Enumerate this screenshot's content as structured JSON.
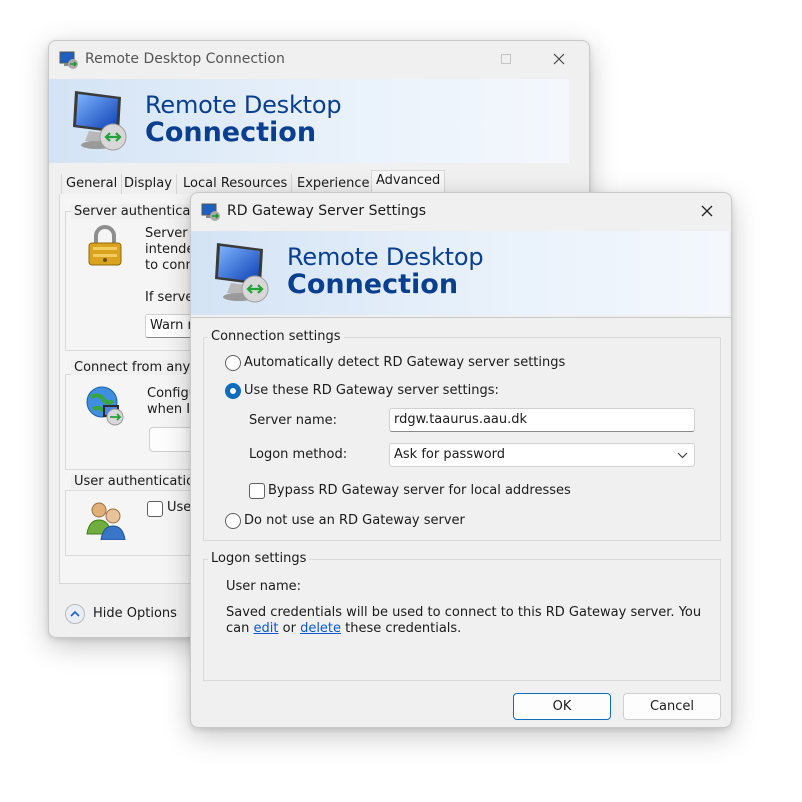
{
  "back_window": {
    "title": "Remote Desktop Connection",
    "banner": {
      "line1": "Remote Desktop",
      "line2": "Connection"
    },
    "tabs": [
      "General",
      "Display",
      "Local Resources",
      "Experience",
      "Advanced"
    ],
    "server_auth": {
      "title": "Server authenticatio",
      "text_lines": [
        "Server a",
        "intende",
        "to conn"
      ],
      "if_server": "If server",
      "select_value": "Warn m"
    },
    "connect_anywhere": {
      "title": "Connect from anywh",
      "text_lines": [
        "Configu",
        "when I a"
      ],
      "button": "S"
    },
    "user_auth": {
      "title": "User authentication",
      "checkbox_label": "Use"
    },
    "hide_options": "Hide Options"
  },
  "dialog": {
    "title": "RD Gateway Server Settings",
    "banner": {
      "line1": "Remote Desktop",
      "line2": "Connection"
    },
    "connection_settings": {
      "title": "Connection settings",
      "radio_auto": "Automatically detect RD Gateway server settings",
      "radio_use": "Use these RD Gateway server settings:",
      "server_name_label": "Server name:",
      "server_name_value": "rdgw.taaurus.aau.dk",
      "logon_method_label": "Logon method:",
      "logon_method_value": "Ask for password",
      "bypass_label": "Bypass RD Gateway server for local addresses",
      "radio_none": "Do not use an RD Gateway server"
    },
    "logon_settings": {
      "title": "Logon settings",
      "user_name_label": "User name:",
      "saved_text": "Saved credentials will be used to connect to this RD Gateway server. You",
      "can": "can",
      "edit": "edit",
      "or": "or",
      "delete": "delete",
      "these": "these credentials."
    },
    "ok": "OK",
    "cancel": "Cancel"
  }
}
